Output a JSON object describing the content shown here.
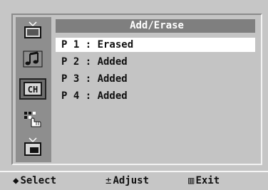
{
  "menu": {
    "title": "Add/Erase",
    "rows": [
      {
        "label": "P 1 : Erased",
        "selected": true
      },
      {
        "label": "P 2 : Added",
        "selected": false
      },
      {
        "label": "P 3 : Added",
        "selected": false
      },
      {
        "label": "P 4 : Added",
        "selected": false
      }
    ]
  },
  "sidebar": {
    "items": [
      {
        "icon": "picture-icon",
        "active": false
      },
      {
        "icon": "sound-icon",
        "active": false
      },
      {
        "icon": "channel-icon",
        "label": "CH",
        "active": true
      },
      {
        "icon": "setup-icon",
        "active": false
      },
      {
        "icon": "input-icon",
        "active": false
      }
    ]
  },
  "footer": {
    "select": {
      "glyph": "◆",
      "label": "Select"
    },
    "adjust": {
      "glyph": "±",
      "label": "Adjust"
    },
    "exit": {
      "glyph": "▥",
      "label": "Exit"
    }
  },
  "colors": {
    "background": "#c6c6c6",
    "title_bar": "#7f7f7f",
    "sidebar": "#8e8e8e",
    "selected_row": "#ffffff"
  }
}
